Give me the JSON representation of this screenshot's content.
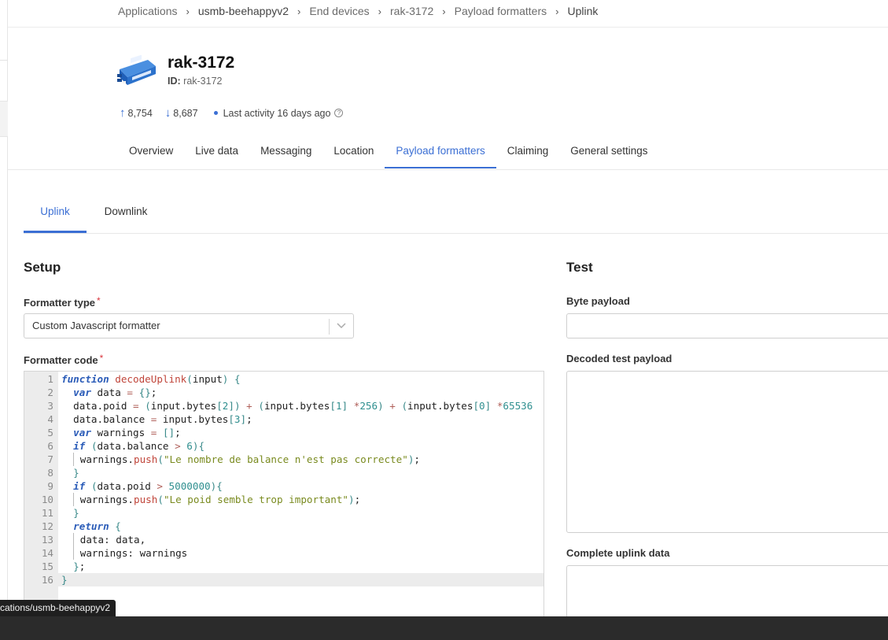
{
  "breadcrumb": {
    "items": [
      "Applications",
      "usmb-beehappyv2",
      "End devices",
      "rak-3172",
      "Payload formatters"
    ],
    "current": "Uplink"
  },
  "device": {
    "name": "rak-3172",
    "id_label": "ID:",
    "id_value": "rak-3172",
    "uplink_count": "8,754",
    "downlink_count": "8,687",
    "last_activity": "Last activity 16 days ago",
    "status_color": "#3b6fd4"
  },
  "device_tabs": [
    "Overview",
    "Live data",
    "Messaging",
    "Location",
    "Payload formatters",
    "Claiming",
    "General settings"
  ],
  "active_device_tab": "Payload formatters",
  "formatter_tabs": {
    "uplink": "Uplink",
    "downlink": "Downlink"
  },
  "setup": {
    "title": "Setup",
    "formatter_type_label": "Formatter type",
    "formatter_type_value": "Custom Javascript formatter",
    "formatter_code_label": "Formatter code",
    "required_mark": "*",
    "code_lines": [
      "function decodeUplink(input) {",
      "  var data = {};",
      "  data.poid = (input.bytes[2]) + (input.bytes[1] *256) + (input.bytes[0] *65536",
      "  data.balance = input.bytes[3];",
      "  var warnings = [];",
      "  if (data.balance > 6){",
      "    warnings.push(\"Le nombre de balance n'est pas correcte\");",
      "  }",
      "  if (data.poid > 5000000){",
      "    warnings.push(\"Le poid semble trop important\");",
      "  }",
      "  return {",
      "    data: data,",
      "    warnings: warnings",
      "  };",
      "}"
    ]
  },
  "test": {
    "title": "Test",
    "byte_payload_label": "Byte payload",
    "byte_payload_value": "",
    "decoded_label": "Decoded test payload",
    "complete_label": "Complete uplink data"
  },
  "status_bar": {
    "url_fragment": "cations/usmb-beehappyv2"
  },
  "colors": {
    "accent": "#3b6fd4",
    "required": "#d9363e"
  }
}
